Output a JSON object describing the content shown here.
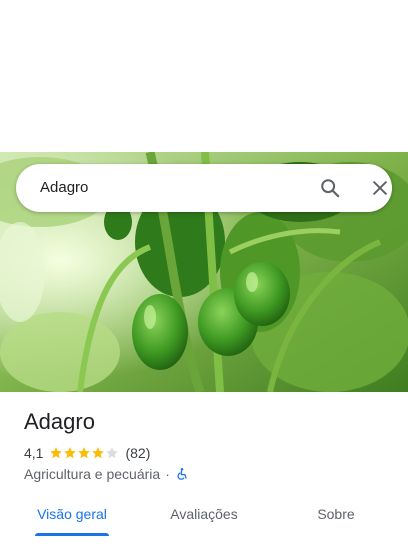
{
  "search": {
    "query": "Adagro",
    "search_icon": "search-icon",
    "close_icon": "close-icon"
  },
  "place": {
    "name": "Adagro",
    "rating": "4,1",
    "rating_value": 4.1,
    "rating_max": 5,
    "review_count": "(82)",
    "category": "Agricultura e pecuária",
    "separator": "·",
    "accessibility_icon": "wheelchair-accessible-icon"
  },
  "tabs": [
    {
      "label": "Visão geral",
      "active": true
    },
    {
      "label": "Avaliações",
      "active": false
    },
    {
      "label": "Sobre",
      "active": false
    }
  ],
  "colors": {
    "accent": "#1a73e8",
    "star": "#fbbc04",
    "star_empty": "#dadce0"
  }
}
